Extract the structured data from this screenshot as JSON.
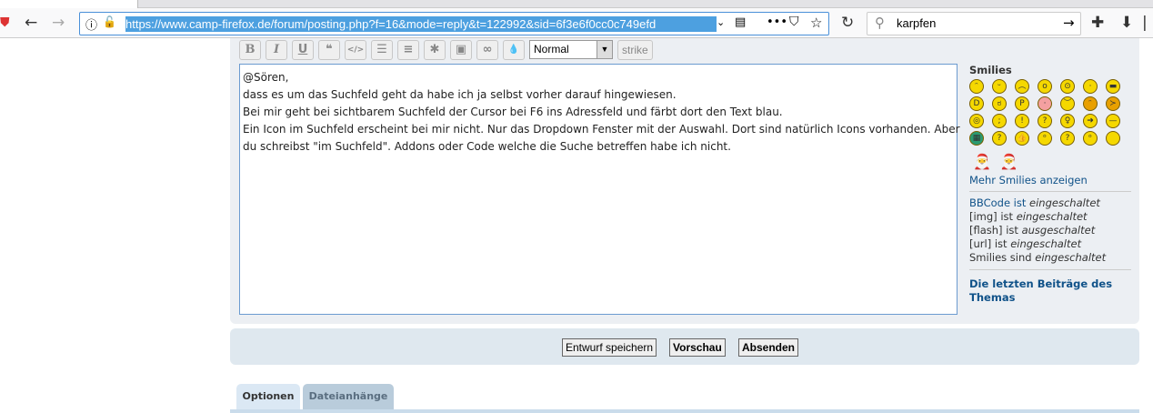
{
  "browser": {
    "url": "https://www.camp-firefox.de/forum/posting.php?f=16&mode=reply&t=122992&sid=6f3e6f0cc0c749efd",
    "search_value": "karpfen"
  },
  "editor": {
    "toolbar": [
      "B",
      "I",
      "U",
      "❝",
      "</>",
      "☰",
      "≡",
      "✱",
      "▣",
      "∞",
      "💧"
    ],
    "font_size": "Normal",
    "strike": "strike",
    "lines": [
      "@Sören,",
      "dass es um das Suchfeld geht da habe ich ja selbst vorher darauf hingewiesen.",
      "Bei mir geht bei sichtbarem Suchfeld der Cursor bei F6 ins Adressfeld und färbt dort den Text blau.",
      "Ein Icon im Suchfeld erscheint bei mir nicht. Nur das Dropdown Fenster mit der Auswahl. Dort sind natürlich Icons vorhanden. Aber",
      "du schreibst \"im Suchfeld\". Addons oder Code welche die Suche betreffen habe ich nicht."
    ]
  },
  "sidebar": {
    "title": "Smilies",
    "more": "Mehr Smilies anzeigen",
    "status": [
      [
        "BBCode ist ",
        "eingeschaltet"
      ],
      [
        "[img] ist ",
        "eingeschaltet"
      ],
      [
        "[flash] ist ",
        "ausgeschaltet"
      ],
      [
        "[url] ist ",
        "eingeschaltet"
      ],
      [
        "Smilies sind ",
        "eingeschaltet"
      ]
    ],
    "recent": "Die letzten Beiträge des Themas"
  },
  "buttons": {
    "draft": "Entwurf speichern",
    "preview": "Vorschau",
    "submit": "Absenden"
  },
  "tabs": {
    "options": "Optionen",
    "attachments": "Dateianhänge"
  }
}
